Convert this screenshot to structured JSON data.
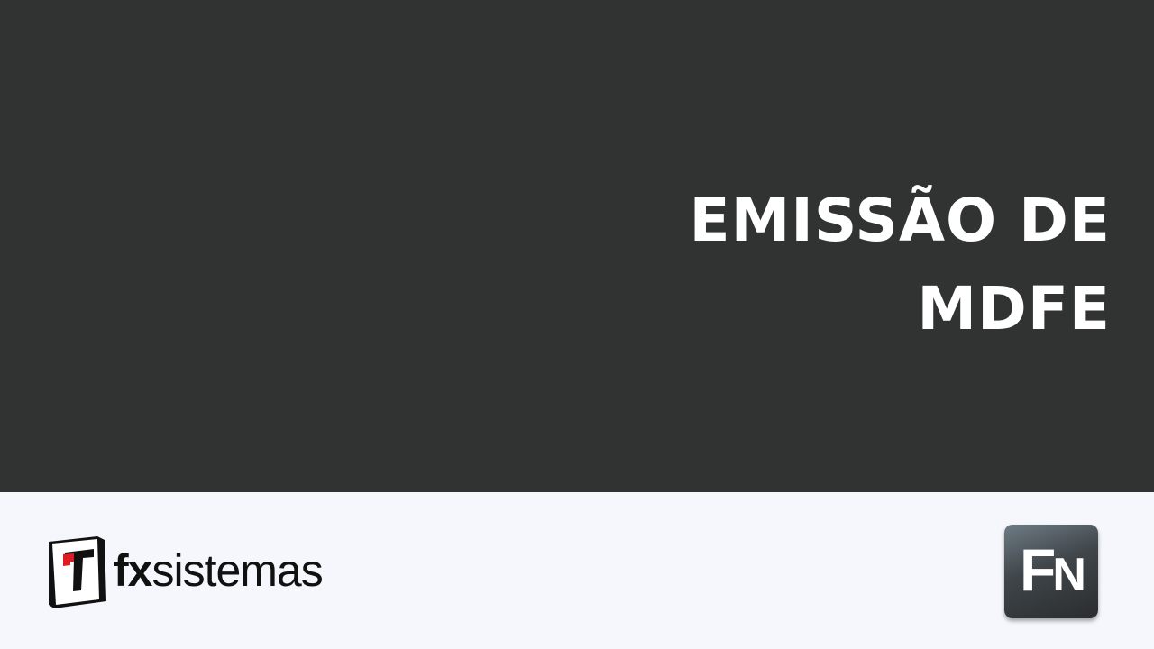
{
  "slide": {
    "title_line_1": "EMISSÃO DE",
    "title_line_2": "MDFE"
  },
  "footer": {
    "brand_bold": "fx",
    "brand_light": "sistemas",
    "app_icon_letter_1": "F",
    "app_icon_letter_2": "N"
  },
  "colors": {
    "hero_background": "#313232",
    "footer_background": "#f5f7fc",
    "title_text": "#ffffff",
    "brand_red": "#e01b22"
  },
  "icons": {
    "brand_logo": "fx-sistemas-logo-icon",
    "app_icon": "fn-app-icon"
  }
}
